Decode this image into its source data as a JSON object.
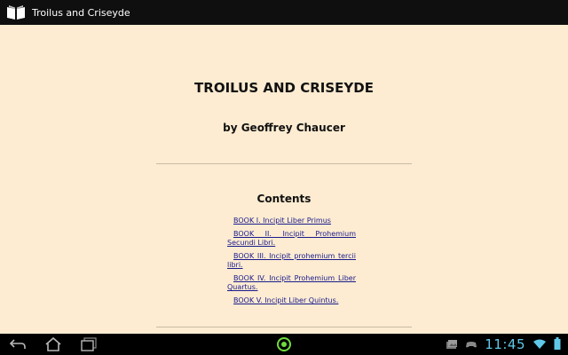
{
  "app_bar": {
    "title": "Troilus and Criseyde",
    "icon": "open-book-icon"
  },
  "book": {
    "title": "TROILUS AND CRISEYDE",
    "author": "by Geoffrey Chaucer",
    "contents_heading": "Contents",
    "toc": [
      {
        "label": "BOOK I. Incipit Liber Primus"
      },
      {
        "label": "BOOK II. Incipit Prohemium Secundi Libri."
      },
      {
        "label": "BOOK III. Incipit prohemium tercii libri."
      },
      {
        "label": "BOOK IV. Incipit Prohemium Liber Quartus."
      },
      {
        "label": "BOOK V. Incipit Liber Quintus."
      }
    ]
  },
  "nav_bar": {
    "back_icon": "back-icon",
    "home_icon": "home-icon",
    "recent_icon": "recent-apps-icon",
    "center_icon": "app-indicator-icon"
  },
  "status": {
    "time": "11:45",
    "icons": [
      "photo-notification-icon",
      "game-controller-icon",
      "wifi-icon",
      "battery-icon"
    ]
  },
  "colors": {
    "page_background": "#fdecd1",
    "link": "#1a1a8c",
    "clock": "#5fc8e8",
    "center_indicator": "#6fdc3c"
  }
}
